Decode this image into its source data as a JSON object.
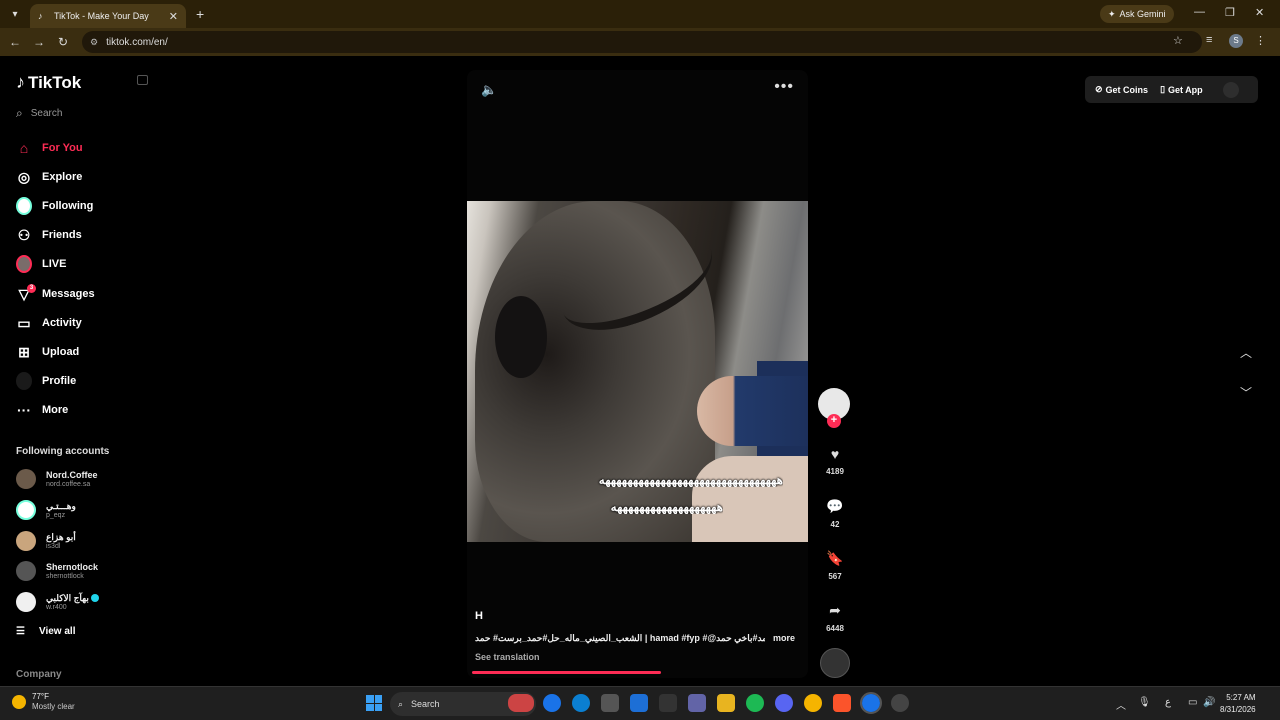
{
  "browser": {
    "tab_title": "TikTok - Make Your Day",
    "new_tab": "+",
    "url": "tiktok.com/en/",
    "ask_gemini": "Ask Gemini",
    "profile_initial": "S"
  },
  "sidebar": {
    "logo": "TikTok",
    "search_placeholder": "Search",
    "nav": [
      {
        "label": "For You",
        "icon": "home-icon"
      },
      {
        "label": "Explore",
        "icon": "compass-icon"
      },
      {
        "label": "Following",
        "icon": "following-avatar"
      },
      {
        "label": "Friends",
        "icon": "friends-icon"
      },
      {
        "label": "LIVE",
        "icon": "live-avatar"
      },
      {
        "label": "Messages",
        "icon": "send-icon",
        "badge": "3"
      },
      {
        "label": "Activity",
        "icon": "activity-icon"
      },
      {
        "label": "Upload",
        "icon": "plus-square-icon"
      },
      {
        "label": "Profile",
        "icon": "profile-avatar"
      },
      {
        "label": "More",
        "icon": "more-dots-icon"
      }
    ],
    "following_header": "Following accounts",
    "accounts": [
      {
        "name": "Nord.Coffee",
        "handle": "nord.coffee.sa"
      },
      {
        "name": "وهـــتـي",
        "handle": "p_eqz"
      },
      {
        "name": "أبو هزاع",
        "handle": "is3dl"
      },
      {
        "name": "Shernotlock",
        "handle": "shernottlock"
      },
      {
        "name": "بهآج الاكلبي",
        "handle": "w.r400"
      }
    ],
    "view_all": "View all",
    "company": "Company"
  },
  "video": {
    "caption_line1": "ههههههههههههههههههههههههههههههههه",
    "caption_line2": "هههههههههههههههههههه",
    "author": "H",
    "description": "الشعب_الصيني_ماله_حل#حمد_برست# حمد | hamad #fyp #@حمد#باخي حمد",
    "more": "more",
    "see_translation": "See translation",
    "progress": 0.57
  },
  "actions": {
    "likes": "4189",
    "comments": "42",
    "saves": "567",
    "shares": "6448"
  },
  "topbar": {
    "get_coins": "Get Coins",
    "get_app": "Get App"
  },
  "taskbar": {
    "temp": "77°F",
    "condition": "Mostly clear",
    "search": "Search",
    "lang": "ع",
    "time": "5:27 AM",
    "date": "8/31/2026"
  }
}
